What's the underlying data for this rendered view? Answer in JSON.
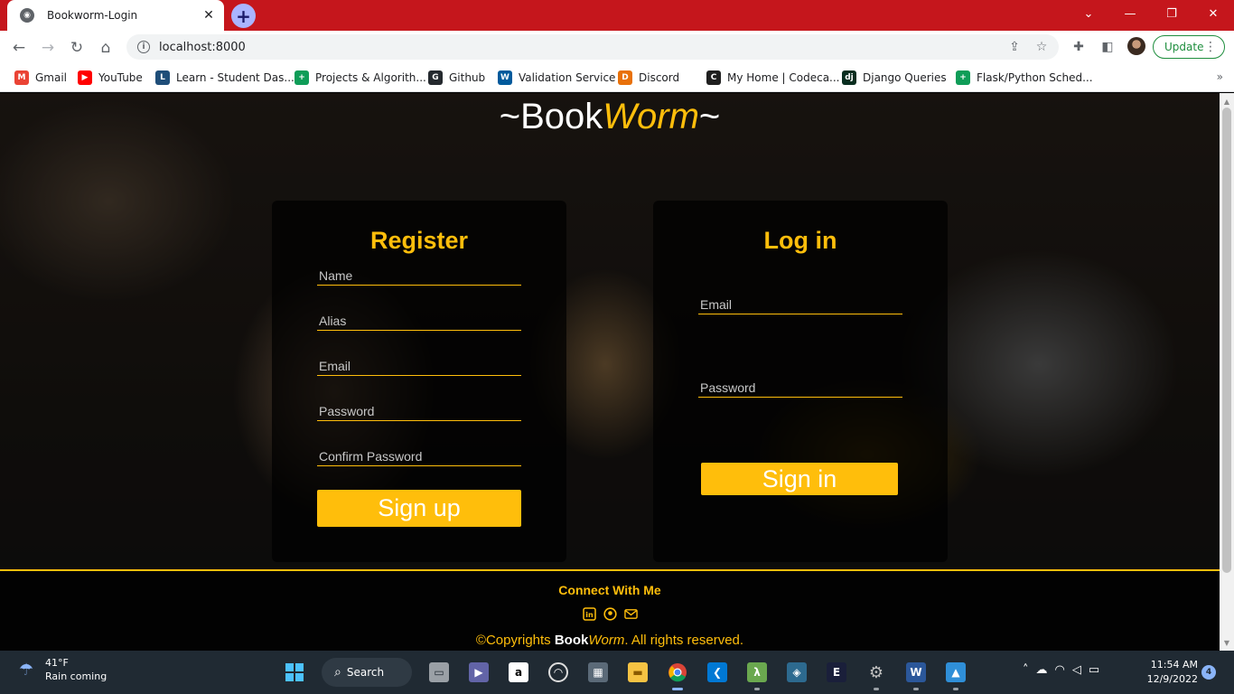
{
  "browser": {
    "tab_title": "Bookworm-Login",
    "tab_close": "✕",
    "new_tab": "+",
    "url": "localhost:8000",
    "update_label": "Update",
    "bookmarks": [
      {
        "label": "Gmail",
        "icon": "gmail-icon",
        "color": "#ea4335",
        "glyph": "M"
      },
      {
        "label": "YouTube",
        "icon": "youtube-icon",
        "color": "#ff0000",
        "glyph": "▶"
      },
      {
        "label": "Learn - Student Das...",
        "icon": "learn-icon",
        "color": "#1f4e79",
        "glyph": "L"
      },
      {
        "label": "Projects & Algorith...",
        "icon": "sheets-icon",
        "color": "#0f9d58",
        "glyph": "+"
      },
      {
        "label": "Github",
        "icon": "github-icon",
        "color": "#24292e",
        "glyph": "G"
      },
      {
        "label": "Validation Service",
        "icon": "w3c-icon",
        "color": "#005a9c",
        "glyph": "W"
      },
      {
        "label": "Discord",
        "icon": "discord-icon",
        "color": "#e8710a",
        "glyph": "D"
      },
      {
        "label": "My Home | Codeca...",
        "icon": "codecademy-icon",
        "color": "#1f1f1f",
        "glyph": "C"
      },
      {
        "label": "Django Queries",
        "icon": "django-icon",
        "color": "#092e20",
        "glyph": "dj"
      },
      {
        "label": "Flask/Python Sched...",
        "icon": "sheets-icon",
        "color": "#0f9d58",
        "glyph": "+"
      }
    ]
  },
  "page": {
    "brand_prefix": "~Book",
    "brand_worm": "Worm",
    "brand_suffix": "~",
    "register": {
      "title": "Register",
      "name_placeholder": "Name",
      "alias_placeholder": "Alias",
      "email_placeholder": "Email",
      "password_placeholder": "Password",
      "confirm_placeholder": "Confirm Password",
      "submit": "Sign up"
    },
    "login": {
      "title": "Log in",
      "email_placeholder": "Email",
      "password_placeholder": "Password",
      "submit": "Sign in"
    },
    "footer": {
      "connect": "Connect With Me",
      "copy_prefix": "©Copyrights ",
      "copy_book": "Book",
      "copy_worm": "Worm",
      "copy_suffix": ". All rights reserved."
    },
    "accent_color": "#ffbe0b"
  },
  "taskbar": {
    "temperature": "41°F",
    "weather": "Rain coming",
    "search_label": "Search",
    "time": "11:54 AM",
    "date": "12/9/2022",
    "notification_count": "4"
  }
}
